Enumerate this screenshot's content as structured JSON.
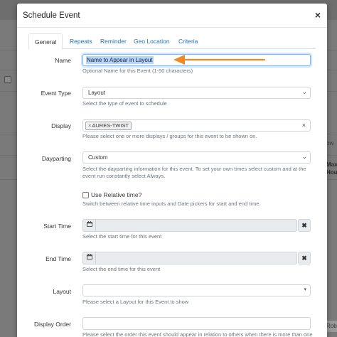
{
  "background": {
    "side_text_1": "ow",
    "side_text_2": "Max",
    "side_text_3": "Hou",
    "robot_tab": "Rob"
  },
  "modal": {
    "title": "Schedule Event",
    "close_label": "×",
    "tabs": [
      {
        "label": "General",
        "active": true
      },
      {
        "label": "Repeats"
      },
      {
        "label": "Reminder"
      },
      {
        "label": "Geo Location"
      },
      {
        "label": "Criteria"
      }
    ]
  },
  "form": {
    "name": {
      "label": "Name",
      "value": "Name to Appear in Layout",
      "help": "Optional Name for this Event (1-50 characters)"
    },
    "event_type": {
      "label": "Event Type",
      "value": "Layout",
      "help": "Select the type of event to schedule"
    },
    "display": {
      "label": "Display",
      "tag": "AURES-TWIST",
      "tag_remove": "×",
      "clear": "×",
      "help": "Please select one or more displays / groups for this event to be shown on."
    },
    "dayparting": {
      "label": "Dayparting",
      "value": "Custom",
      "help_line1": "Select the dayparting information for this event. To set your own times select custom and at the",
      "help_line2": "event run constantly select Always."
    },
    "relative_time": {
      "label": "Use Relative time?",
      "checked": false,
      "help": "Switch between relative time inputs and Date pickers for start and end time."
    },
    "start_time": {
      "label": "Start Time",
      "help": "Select the start time for this event",
      "clear": "✖"
    },
    "end_time": {
      "label": "End Time",
      "help": "Select the end time for this event",
      "clear": "✖"
    },
    "layout": {
      "label": "Layout",
      "value": "",
      "help": "Please select a Layout for this Event to show"
    },
    "display_order": {
      "label": "Display Order",
      "value": "",
      "help": "Please select the order this event should appear in relation to others when there is more than one"
    }
  },
  "icons": {
    "calendar": "calendar-icon",
    "chevron": "chevron-down-icon"
  },
  "colors": {
    "accent": "#1f6fb2",
    "annotation_arrow": "#f08a24",
    "focus_border": "#80bdff"
  }
}
